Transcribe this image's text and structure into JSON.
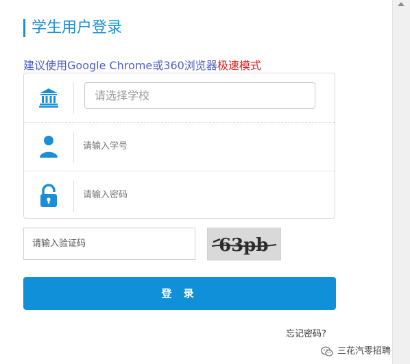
{
  "header": {
    "title": "学生用户登录"
  },
  "tip": {
    "text": "建议使用Google Chrome或360浏览器",
    "highlight": "极速模式"
  },
  "form": {
    "school_placeholder": "请选择学校",
    "student_id_placeholder": "请输入学号",
    "password_placeholder": "请输入密码",
    "captcha_placeholder": "请输入验证码",
    "captcha_text": "63pb",
    "login_label": "登 录",
    "forgot_label": "忘记密码?"
  },
  "icons": {
    "school": "school-building-icon",
    "user": "user-icon",
    "lock": "lock-icon",
    "wechat": "wechat-icon"
  },
  "colors": {
    "accent": "#1a8fd6",
    "button": "#0f90d8",
    "tip_text": "#4c5fc4",
    "tip_highlight": "#e02020"
  },
  "watermark": {
    "text": "三花汽零招聘"
  }
}
